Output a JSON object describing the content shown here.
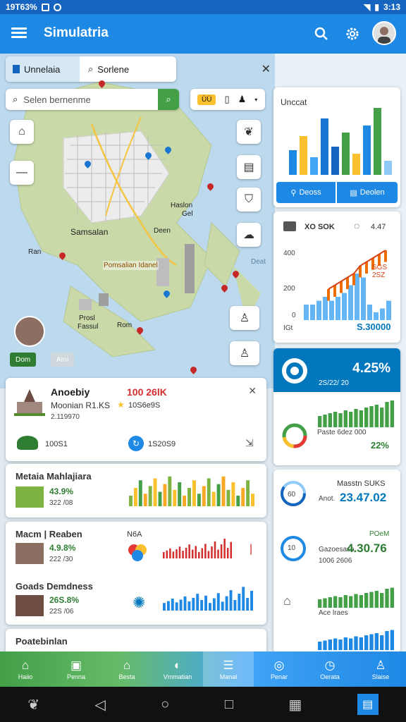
{
  "status_bar": {
    "time_left": "19T63%",
    "time_right": "3:13"
  },
  "app": {
    "title": "Simulatria"
  },
  "map": {
    "tab_label": "Unnelaia",
    "search_small": "Sorlene",
    "search_placeholder": "Selen bernenme",
    "chip_badge": "ÜÜ",
    "labels": [
      "Haslon",
      "Gel",
      "Samsalan",
      "Deen",
      "Ran",
      "Pomsalian Idanel",
      "Prosl",
      "Rom",
      "Fassul",
      "Deat"
    ],
    "bottom_chip_1": "Dom",
    "bottom_chip_2": "Ami"
  },
  "stat_card": {
    "title": "Unccat",
    "btn1": "Deoss",
    "btn2": "Deolen",
    "bars": [
      35,
      55,
      25,
      80,
      40,
      60,
      30,
      70,
      95,
      20
    ],
    "colors": [
      "#1e88e5",
      "#fbc02d",
      "#42a5f5",
      "#1976d2",
      "#1565c0",
      "#43a047",
      "#fbc02d",
      "#1e88e5",
      "#43a047",
      "#90caf9"
    ]
  },
  "chart_card": {
    "header": "XO SOK",
    "header_right": "4.47",
    "y_ticks": [
      "400",
      "200",
      "0"
    ],
    "footer_left": "IGt",
    "footer_value": "S.30000",
    "legend": "SGS 2SZ",
    "bars": [
      0.2,
      0.2,
      0.25,
      0.3,
      0.25,
      0.3,
      0.35,
      0.45,
      0.6,
      0.55,
      0.2,
      0.1,
      0.15,
      0.25
    ],
    "line": [
      0.4,
      0.45,
      0.5,
      0.55,
      0.6,
      0.7,
      0.75,
      0.8,
      0.85,
      0.9
    ]
  },
  "kpi_card": {
    "value": "4.25%",
    "sub": "2S/22/ 20",
    "label": "Paste 6dez 000",
    "pct": "22%",
    "bars": [
      0.4,
      0.45,
      0.5,
      0.55,
      0.5,
      0.6,
      0.55,
      0.65,
      0.6,
      0.7,
      0.75,
      0.8,
      0.7,
      0.9,
      0.95
    ]
  },
  "detail_card": {
    "name": "Anoebiy",
    "value": "100 26lK",
    "subtitle": "Moonian R1.KS",
    "sub_extra": "10S6e9S",
    "number": "2.119970",
    "stat1": "100S1",
    "stat2": "1S20S9"
  },
  "list": [
    {
      "title": "Metaia Mahlajiara",
      "pct": "43.9%",
      "num": "322 /08",
      "color": "#7cb342"
    },
    {
      "title": "Macm | Reaben",
      "tag": "N6A",
      "pct": "4.9.8%",
      "num": "222 /30",
      "color": "#d32f2f"
    },
    {
      "title": "Goads Demdness",
      "pct": "26S.8%",
      "num": "22S /06",
      "color": "#1e88e5"
    },
    {
      "title": "Poatebinlan"
    }
  ],
  "right_list": [
    {
      "title": "Masstn SUKS",
      "value": "23.47.02",
      "label": "Anot.",
      "sub": "",
      "icon": "60"
    },
    {
      "title": "POeM",
      "value": "4.30.76",
      "label": "Gazoesaso",
      "sub": "1006 2606",
      "icon": "10"
    },
    {
      "title": "",
      "value": "",
      "label": "Ace lraes",
      "sub": "",
      "icon": ""
    }
  ],
  "bottom_nav": [
    "Haiio",
    "Penna",
    "Besta",
    "Vmmatian",
    "Manal",
    "Penar",
    "Oerata",
    "Slaise"
  ]
}
